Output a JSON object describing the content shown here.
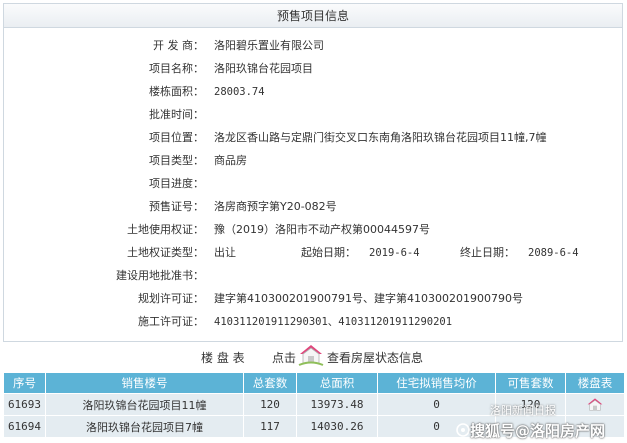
{
  "panel": {
    "title": "预售项目信息",
    "fields": [
      {
        "label": "开 发 商：",
        "value": "洛阳碧乐置业有限公司"
      },
      {
        "label": "项目名称：",
        "value": "洛阳玖锦台花园项目"
      },
      {
        "label": "楼栋面积：",
        "value": "28003.74"
      },
      {
        "label": "批准时间：",
        "value": ""
      },
      {
        "label": "项目位置：",
        "value": "洛龙区香山路与定鼎门街交叉口东南角洛阳玖锦台花园项目11幢,7幢"
      },
      {
        "label": "项目类型：",
        "value": "商品房"
      },
      {
        "label": "项目进度：",
        "value": ""
      },
      {
        "label": "预售证号：",
        "value": "洛房商预字第Y20-082号"
      },
      {
        "label": "土地使用权证：",
        "value": "豫（2019）洛阳市不动产权第00044597号"
      },
      {
        "label": "土地权证类型：",
        "value": "出让"
      },
      {
        "label": "建设用地批准书：",
        "value": ""
      },
      {
        "label": "规划许可证：",
        "value": "建字第410300201900791号、建字第410300201900790号"
      },
      {
        "label": "施工许可证：",
        "value": "410311201911290301、410311201911290201"
      }
    ],
    "start_date_label": "起始日期：",
    "start_date": "2019-6-4",
    "end_date_label": "终止日期：",
    "end_date": "2089-6-4"
  },
  "house_bar": {
    "title": "楼 盘 表",
    "click_label": "点击",
    "view_label": "查看房屋状态信息",
    "icon": "house-icon"
  },
  "table": {
    "headers": [
      "序号",
      "销售楼号",
      "总套数",
      "总面积",
      "住宅拟销售均价",
      "可售套数",
      "楼盘表"
    ],
    "rows": [
      [
        "61693",
        "洛阳玖锦台花园项目11幢",
        "120",
        "13973.48",
        "0",
        "120",
        ""
      ],
      [
        "61694",
        "洛阳玖锦台花园项目7幢",
        "117",
        "14030.26",
        "0",
        "",
        ""
      ]
    ]
  },
  "watermark": {
    "main": "搜狐号@洛阳房产网",
    "secondary": "洛阳新闻日报"
  },
  "colors": {
    "header_bg": "#5cb3d6",
    "row_bg": "#e4ecf1",
    "house_roof": "#e0457b"
  }
}
